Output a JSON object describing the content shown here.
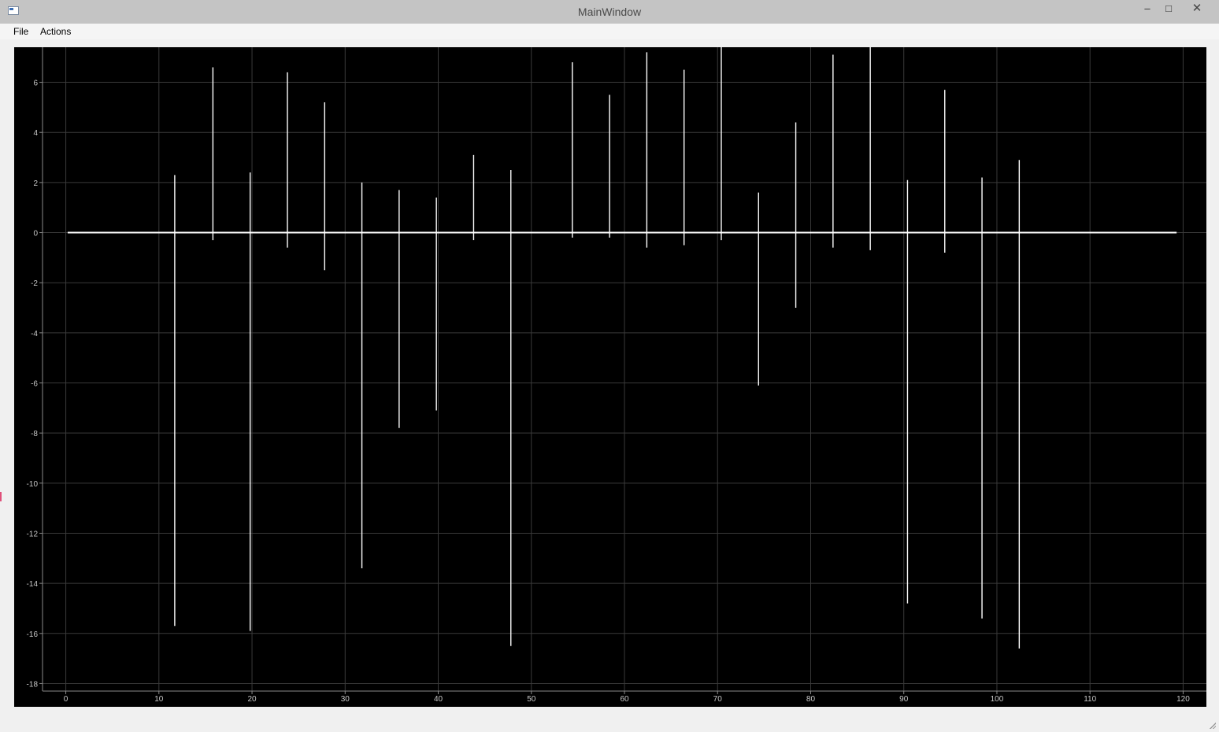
{
  "window": {
    "title": "MainWindow",
    "minimize_glyph": "–",
    "maximize_glyph": "□",
    "close_glyph": "✕"
  },
  "menu": {
    "items": [
      {
        "label": "File"
      },
      {
        "label": "Actions"
      }
    ]
  },
  "colors": {
    "plot_background": "#000000",
    "trace": "#ffffff",
    "grid": "#3a3a3a",
    "tick_label": "#c8c8c8"
  },
  "chart_data": {
    "type": "line",
    "title": "",
    "xlabel": "",
    "ylabel": "",
    "xlim": [
      -2.5,
      122.5
    ],
    "ylim": [
      -18.3,
      7.4
    ],
    "xticks": [
      0,
      10,
      20,
      30,
      40,
      50,
      60,
      70,
      80,
      90,
      100,
      110,
      120
    ],
    "yticks": [
      -18,
      -16,
      -14,
      -12,
      -10,
      -8,
      -6,
      -4,
      -2,
      0,
      2,
      4,
      6
    ],
    "grid": true,
    "baseline": {
      "x_start": 0.2,
      "x_end": 119.3,
      "y": 0
    },
    "spikes": [
      {
        "x": 11.7,
        "max": 2.3,
        "min": -15.7
      },
      {
        "x": 15.8,
        "max": 6.6,
        "min": -0.3
      },
      {
        "x": 19.8,
        "max": 2.4,
        "min": -15.9
      },
      {
        "x": 23.8,
        "max": 6.4,
        "min": -0.6
      },
      {
        "x": 27.8,
        "max": 5.2,
        "min": -1.5
      },
      {
        "x": 31.8,
        "max": 2.0,
        "min": -13.4
      },
      {
        "x": 35.8,
        "max": 1.7,
        "min": -7.8
      },
      {
        "x": 39.8,
        "max": 1.4,
        "min": -7.1
      },
      {
        "x": 43.8,
        "max": 3.1,
        "min": -0.3
      },
      {
        "x": 47.8,
        "max": 2.5,
        "min": -16.5
      },
      {
        "x": 54.4,
        "max": 6.8,
        "min": -0.2
      },
      {
        "x": 58.4,
        "max": 5.5,
        "min": -0.2
      },
      {
        "x": 62.4,
        "max": 7.2,
        "min": -0.6
      },
      {
        "x": 66.4,
        "max": 6.5,
        "min": -0.5
      },
      {
        "x": 70.4,
        "max": 7.4,
        "min": -0.3
      },
      {
        "x": 74.4,
        "max": 1.6,
        "min": -6.1
      },
      {
        "x": 78.4,
        "max": 4.4,
        "min": -3.0
      },
      {
        "x": 82.4,
        "max": 7.1,
        "min": -0.6
      },
      {
        "x": 86.4,
        "max": 7.4,
        "min": -0.7
      },
      {
        "x": 90.4,
        "max": 2.1,
        "min": -14.8
      },
      {
        "x": 94.4,
        "max": 5.7,
        "min": -0.8
      },
      {
        "x": 98.4,
        "max": 2.2,
        "min": -15.4
      },
      {
        "x": 102.4,
        "max": 2.9,
        "min": -16.6
      }
    ]
  }
}
